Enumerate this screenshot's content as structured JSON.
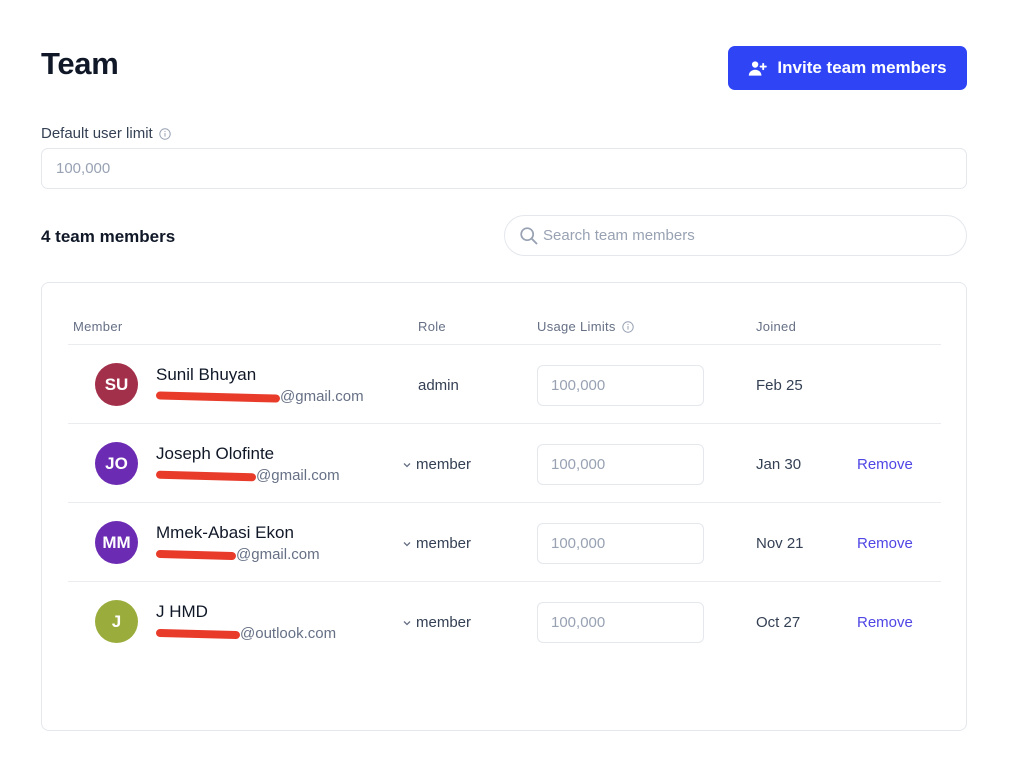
{
  "header": {
    "title": "Team",
    "invite_label": "Invite team members"
  },
  "default_limit": {
    "label": "Default user limit",
    "placeholder": "100,000"
  },
  "members_section": {
    "count_label": "4 team members",
    "search_placeholder": "Search team members"
  },
  "table": {
    "columns": {
      "member": "Member",
      "role": "Role",
      "usage": "Usage Limits",
      "joined": "Joined"
    },
    "rows": [
      {
        "initials": "SU",
        "avatar_color": "#a3304a",
        "name": "Sunil Bhuyan",
        "email_visible": "@gmail.com",
        "role": "admin",
        "role_editable": false,
        "usage_placeholder": "100,000",
        "joined": "Feb 25",
        "remove_label": ""
      },
      {
        "initials": "JO",
        "avatar_color": "#6b2bb3",
        "name": "Joseph Olofinte",
        "email_visible": "@gmail.com",
        "role": "member",
        "role_editable": true,
        "usage_placeholder": "100,000",
        "joined": "Jan 30",
        "remove_label": "Remove"
      },
      {
        "initials": "MM",
        "avatar_color": "#6b2bb3",
        "name": "Mmek-Abasi Ekon",
        "email_visible": "@gmail.com",
        "role": "member",
        "role_editable": true,
        "usage_placeholder": "100,000",
        "joined": "Nov 21",
        "remove_label": "Remove"
      },
      {
        "initials": "J",
        "avatar_color": "#9aad3c",
        "name": "J HMD",
        "email_visible": "@outlook.com",
        "role": "member",
        "role_editable": true,
        "usage_placeholder": "100,000",
        "joined": "Oct 27",
        "remove_label": "Remove"
      }
    ]
  },
  "colors": {
    "accent": "#2f45f5",
    "remove_link": "#4f46e5",
    "redaction": "#e83b2a"
  },
  "icons": {
    "invite": "user-plus-icon",
    "info": "info-icon",
    "search": "search-icon",
    "role_dropdown": "chevron-down-icon"
  }
}
